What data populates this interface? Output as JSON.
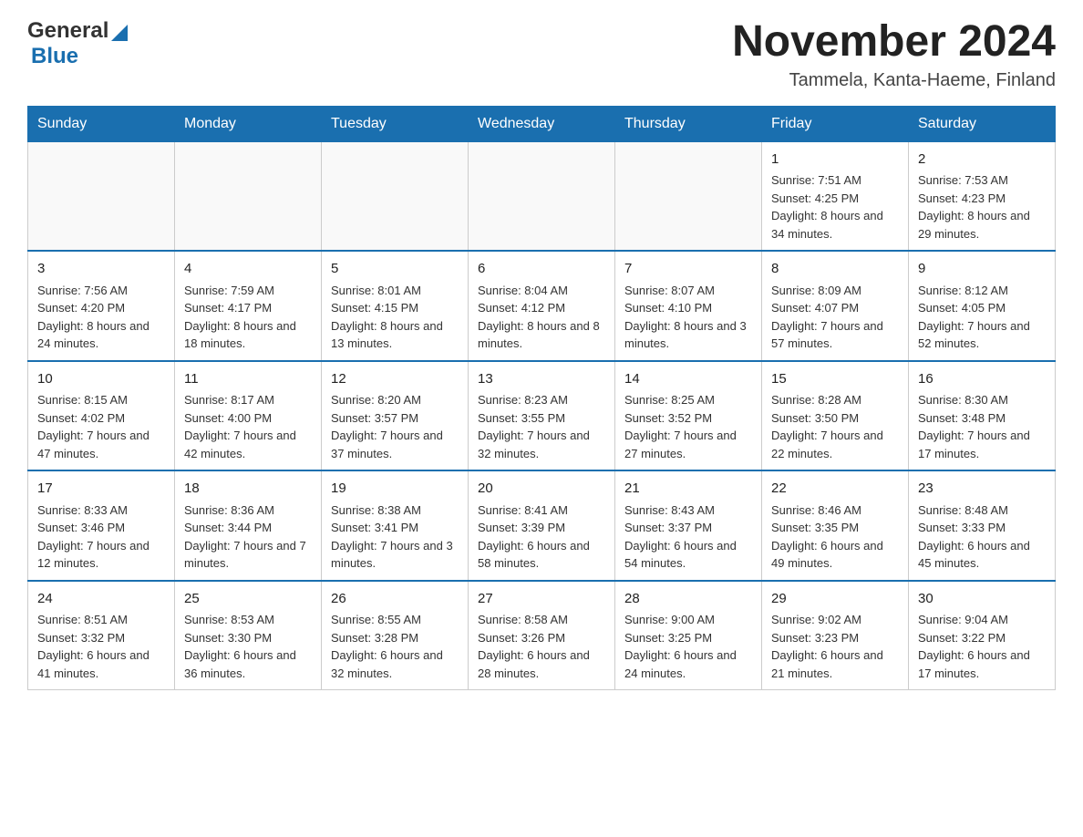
{
  "header": {
    "logo_general": "General",
    "logo_blue": "Blue",
    "month_title": "November 2024",
    "location": "Tammela, Kanta-Haeme, Finland"
  },
  "weekdays": [
    "Sunday",
    "Monday",
    "Tuesday",
    "Wednesday",
    "Thursday",
    "Friday",
    "Saturday"
  ],
  "rows": [
    {
      "cells": [
        {
          "day": "",
          "info": ""
        },
        {
          "day": "",
          "info": ""
        },
        {
          "day": "",
          "info": ""
        },
        {
          "day": "",
          "info": ""
        },
        {
          "day": "",
          "info": ""
        },
        {
          "day": "1",
          "info": "Sunrise: 7:51 AM\nSunset: 4:25 PM\nDaylight: 8 hours and 34 minutes."
        },
        {
          "day": "2",
          "info": "Sunrise: 7:53 AM\nSunset: 4:23 PM\nDaylight: 8 hours and 29 minutes."
        }
      ]
    },
    {
      "cells": [
        {
          "day": "3",
          "info": "Sunrise: 7:56 AM\nSunset: 4:20 PM\nDaylight: 8 hours and 24 minutes."
        },
        {
          "day": "4",
          "info": "Sunrise: 7:59 AM\nSunset: 4:17 PM\nDaylight: 8 hours and 18 minutes."
        },
        {
          "day": "5",
          "info": "Sunrise: 8:01 AM\nSunset: 4:15 PM\nDaylight: 8 hours and 13 minutes."
        },
        {
          "day": "6",
          "info": "Sunrise: 8:04 AM\nSunset: 4:12 PM\nDaylight: 8 hours and 8 minutes."
        },
        {
          "day": "7",
          "info": "Sunrise: 8:07 AM\nSunset: 4:10 PM\nDaylight: 8 hours and 3 minutes."
        },
        {
          "day": "8",
          "info": "Sunrise: 8:09 AM\nSunset: 4:07 PM\nDaylight: 7 hours and 57 minutes."
        },
        {
          "day": "9",
          "info": "Sunrise: 8:12 AM\nSunset: 4:05 PM\nDaylight: 7 hours and 52 minutes."
        }
      ]
    },
    {
      "cells": [
        {
          "day": "10",
          "info": "Sunrise: 8:15 AM\nSunset: 4:02 PM\nDaylight: 7 hours and 47 minutes."
        },
        {
          "day": "11",
          "info": "Sunrise: 8:17 AM\nSunset: 4:00 PM\nDaylight: 7 hours and 42 minutes."
        },
        {
          "day": "12",
          "info": "Sunrise: 8:20 AM\nSunset: 3:57 PM\nDaylight: 7 hours and 37 minutes."
        },
        {
          "day": "13",
          "info": "Sunrise: 8:23 AM\nSunset: 3:55 PM\nDaylight: 7 hours and 32 minutes."
        },
        {
          "day": "14",
          "info": "Sunrise: 8:25 AM\nSunset: 3:52 PM\nDaylight: 7 hours and 27 minutes."
        },
        {
          "day": "15",
          "info": "Sunrise: 8:28 AM\nSunset: 3:50 PM\nDaylight: 7 hours and 22 minutes."
        },
        {
          "day": "16",
          "info": "Sunrise: 8:30 AM\nSunset: 3:48 PM\nDaylight: 7 hours and 17 minutes."
        }
      ]
    },
    {
      "cells": [
        {
          "day": "17",
          "info": "Sunrise: 8:33 AM\nSunset: 3:46 PM\nDaylight: 7 hours and 12 minutes."
        },
        {
          "day": "18",
          "info": "Sunrise: 8:36 AM\nSunset: 3:44 PM\nDaylight: 7 hours and 7 minutes."
        },
        {
          "day": "19",
          "info": "Sunrise: 8:38 AM\nSunset: 3:41 PM\nDaylight: 7 hours and 3 minutes."
        },
        {
          "day": "20",
          "info": "Sunrise: 8:41 AM\nSunset: 3:39 PM\nDaylight: 6 hours and 58 minutes."
        },
        {
          "day": "21",
          "info": "Sunrise: 8:43 AM\nSunset: 3:37 PM\nDaylight: 6 hours and 54 minutes."
        },
        {
          "day": "22",
          "info": "Sunrise: 8:46 AM\nSunset: 3:35 PM\nDaylight: 6 hours and 49 minutes."
        },
        {
          "day": "23",
          "info": "Sunrise: 8:48 AM\nSunset: 3:33 PM\nDaylight: 6 hours and 45 minutes."
        }
      ]
    },
    {
      "cells": [
        {
          "day": "24",
          "info": "Sunrise: 8:51 AM\nSunset: 3:32 PM\nDaylight: 6 hours and 41 minutes."
        },
        {
          "day": "25",
          "info": "Sunrise: 8:53 AM\nSunset: 3:30 PM\nDaylight: 6 hours and 36 minutes."
        },
        {
          "day": "26",
          "info": "Sunrise: 8:55 AM\nSunset: 3:28 PM\nDaylight: 6 hours and 32 minutes."
        },
        {
          "day": "27",
          "info": "Sunrise: 8:58 AM\nSunset: 3:26 PM\nDaylight: 6 hours and 28 minutes."
        },
        {
          "day": "28",
          "info": "Sunrise: 9:00 AM\nSunset: 3:25 PM\nDaylight: 6 hours and 24 minutes."
        },
        {
          "day": "29",
          "info": "Sunrise: 9:02 AM\nSunset: 3:23 PM\nDaylight: 6 hours and 21 minutes."
        },
        {
          "day": "30",
          "info": "Sunrise: 9:04 AM\nSunset: 3:22 PM\nDaylight: 6 hours and 17 minutes."
        }
      ]
    }
  ]
}
